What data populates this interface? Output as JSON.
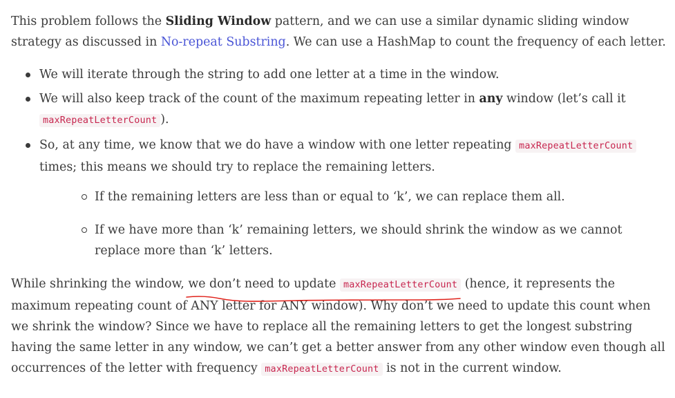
{
  "paragraph1": {
    "before_bold": "This problem follows the ",
    "bold": "Sliding Window",
    "after_bold": " pattern, and we can use a similar dynamic sliding window strategy as discussed in ",
    "link_text": "No-repeat Substring",
    "after_link": ". We can use a HashMap to count the frequency of each letter."
  },
  "bullets": {
    "item1": "We will iterate through the string to add one letter at a time in the window.",
    "item2": {
      "before_bold": "We will also keep track of the count of the maximum repeating letter in ",
      "bold": "any",
      "after_bold": " window (let’s call it ",
      "code": "maxRepeatLetterCount",
      "end": ")."
    },
    "item3": {
      "before_code": "So, at any time, we know that we do have a window with one letter repeating ",
      "code": "maxRepeatLetterCount",
      "after_code": " times; this means we should try to replace the remaining letters."
    },
    "sub_items": {
      "sub1": "If the remaining letters are less than or equal to ‘k’, we can replace them all.",
      "sub2": "If we have more than ‘k’ remaining letters, we should shrink the window as we cannot replace more than ‘k’ letters."
    }
  },
  "paragraph2": {
    "before_code": "While shrinking the window, we don’t need to update ",
    "code": "maxRepeatLetterCount",
    "middle": " (hence, it represents the maximum repeating count of ANY letter for ANY window). Why don’t we need to update this count when we shrink the window? Since we have to replace all the remaining letters to get the longest substring having the same letter in any window, we can’t get a better answer from any other window even though all occurrences of the letter with frequency ",
    "code2": "maxRepeatLetterCount",
    "end": " is not in the current window."
  },
  "colors": {
    "text": "#3b3b3b",
    "link": "#4a55d6",
    "code_text": "#c7254e",
    "code_bg": "#f7f2f3",
    "annotation": "#e0231c"
  }
}
